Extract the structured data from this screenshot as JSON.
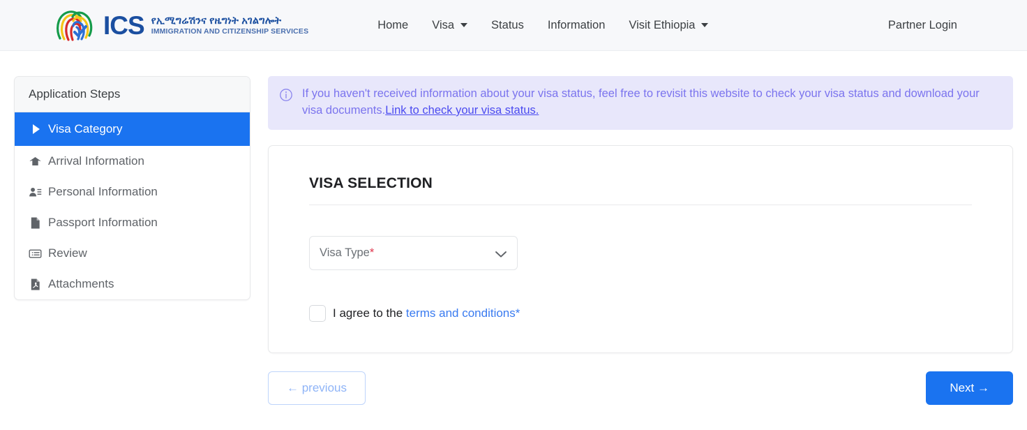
{
  "header": {
    "brand": {
      "ics": "ICS",
      "amharic": "የኢሚግሬሽንና የዜግነት አገልግሎት",
      "english": "IMMIGRATION AND CITIZENSHIP SERVICES",
      "logo_icon": "fingerprint-logo-icon"
    },
    "nav": [
      {
        "label": "Home",
        "has_caret": false
      },
      {
        "label": "Visa",
        "has_caret": true
      },
      {
        "label": "Status",
        "has_caret": false
      },
      {
        "label": "Information",
        "has_caret": false
      },
      {
        "label": "Visit Ethiopia",
        "has_caret": true
      }
    ],
    "partner_login": "Partner Login"
  },
  "sidebar": {
    "title": "Application Steps",
    "items": [
      {
        "label": "Visa Category",
        "icon": "triangle-right-icon",
        "active": true
      },
      {
        "label": "Arrival Information",
        "icon": "home-icon",
        "active": false
      },
      {
        "label": "Personal Information",
        "icon": "person-details-icon",
        "active": false
      },
      {
        "label": "Passport Information",
        "icon": "document-icon",
        "active": false
      },
      {
        "label": "Review",
        "icon": "id-card-icon",
        "active": false
      },
      {
        "label": "Attachments",
        "icon": "pdf-file-icon",
        "active": false
      }
    ]
  },
  "alert": {
    "icon": "info-circle-icon",
    "text": "If you haven't received information about your visa status, feel free to revisit this website to check your visa status and download your visa documents.",
    "link_text": "Link to check your visa status."
  },
  "form": {
    "section_title": "VISA SELECTION",
    "visa_type": {
      "label": "Visa Type",
      "required_marker": "*",
      "value": "",
      "placeholder": "Visa Type",
      "chevron_icon": "chevron-down-icon"
    },
    "agree": {
      "checked": false,
      "prefix": "I agree to the ",
      "link_text": "terms and conditions",
      "required_marker": "*"
    }
  },
  "buttons": {
    "previous": "← previous",
    "next": "Next →"
  },
  "colors": {
    "accent_blue": "#1a73f0",
    "brand_navy": "#1b4fa0",
    "alert_bg": "#e8e7fb",
    "alert_text": "#7b74ee",
    "alert_link": "#4a4af0",
    "required_red": "#e0384f",
    "link_blue": "#3a7bf0",
    "header_bg": "#f7f8fa"
  }
}
